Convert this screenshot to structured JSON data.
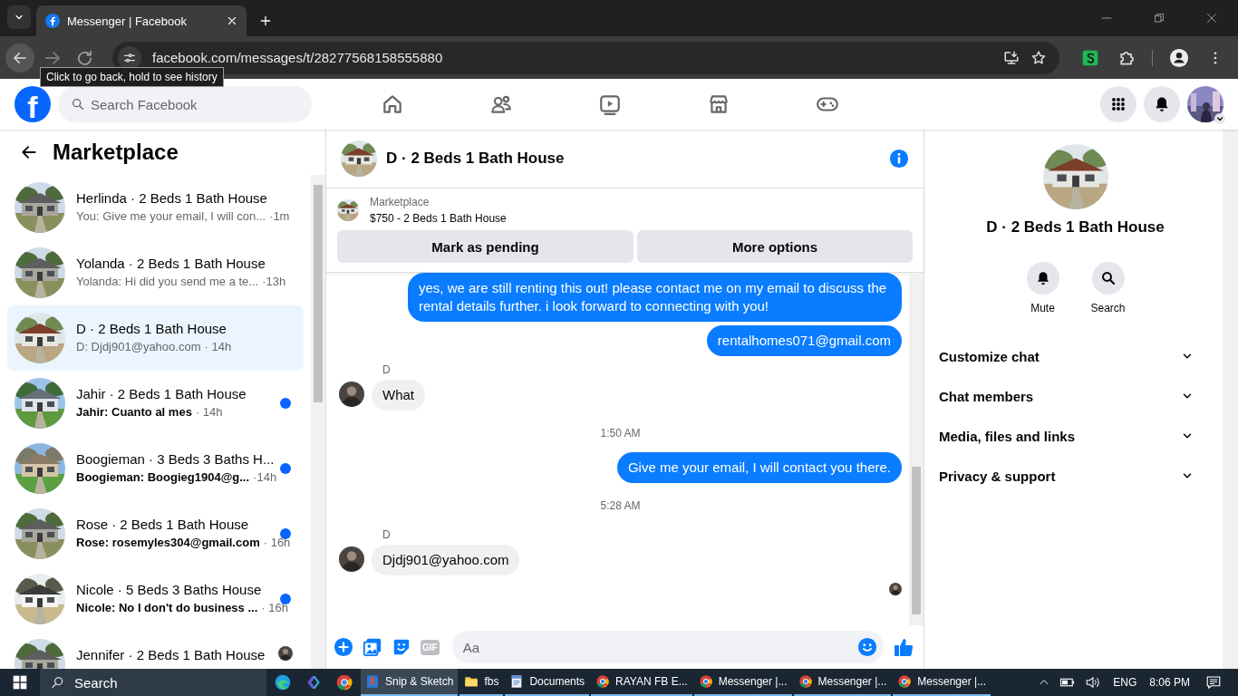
{
  "browser": {
    "tabs": [
      {
        "title": "Messenger | Facebook",
        "selected": true
      }
    ],
    "address": "facebook.com/messages/t/28277568158555880",
    "tooltip": "Click to go back, hold to see history"
  },
  "header": {
    "logo": "f",
    "search_placeholder": "Search Facebook"
  },
  "sidebar": {
    "title": "Marketplace",
    "conversations": [
      {
        "name": "Herlinda · 2 Beds 1 Bath House",
        "preview": "You: Give me your email, I will con...",
        "time": "·1m",
        "unread": false,
        "selected": false
      },
      {
        "name": "Yolanda · 2 Beds 1 Bath House",
        "preview": "Yolanda: Hi did you send me a te...",
        "time": "·13h",
        "unread": false,
        "selected": false
      },
      {
        "name": "D · 2 Beds 1 Bath House",
        "preview": "D: Djdj901@yahoo.com",
        "time": "· 14h",
        "unread": false,
        "selected": true
      },
      {
        "name": "Jahir · 2 Beds 1 Bath House",
        "preview": "Jahir: Cuanto al mes",
        "time": "· 14h",
        "unread": true,
        "selected": false
      },
      {
        "name": "Boogieman · 3 Beds 3 Baths H...",
        "preview": "Boogieman: Boogieg1904@g...",
        "time": "·14h",
        "unread": true,
        "selected": false
      },
      {
        "name": "Rose · 2 Beds 1 Bath House",
        "preview": "Rose: rosemyles304@gmail.com",
        "time": "· 16h",
        "unread": true,
        "selected": false
      },
      {
        "name": "Nicole · 5 Beds 3 Baths House",
        "preview": "Nicole: No I don't do business ...",
        "time": "· 16h",
        "unread": true,
        "selected": false
      },
      {
        "name": "Jennifer · 2 Beds 1 Bath House",
        "unread": false,
        "seen": true,
        "selected": false
      }
    ]
  },
  "chat": {
    "title": "D · 2 Beds 1 Bath House",
    "listing": {
      "label": "Marketplace",
      "title": "$750 - 2 Beds 1 Bath House"
    },
    "buttons": [
      "Mark as pending",
      "More options"
    ],
    "messages": [
      {
        "kind": "outgoing",
        "text": "yes, we are still renting this out! please contact me on my email to discuss the rental details further. i look forward to connecting with you!"
      },
      {
        "kind": "outgoing",
        "text": "rentalhomes071@gmail.com"
      },
      {
        "kind": "incoming",
        "sender": "D",
        "text": "What"
      },
      {
        "kind": "time",
        "text": "1:50 AM"
      },
      {
        "kind": "outgoing",
        "text": "Give me your email, I will contact you there."
      },
      {
        "kind": "time",
        "text": "5:28 AM"
      },
      {
        "kind": "incoming",
        "sender": "D",
        "text": "Djdj901@yahoo.com"
      }
    ],
    "seen": true,
    "composer": {
      "gif": "GIF",
      "placeholder": "Aa"
    }
  },
  "details": {
    "title": "D · 2 Beds 1 Bath House",
    "actions": [
      {
        "kind": "mute",
        "label": "Mute"
      },
      {
        "kind": "search",
        "label": "Search"
      }
    ],
    "sections": [
      {
        "label": "Customize chat",
        "expanded": false
      },
      {
        "label": "Chat members",
        "expanded": false
      },
      {
        "label": "Media, files and links",
        "expanded": false
      },
      {
        "label": "Privacy & support",
        "expanded": false
      }
    ]
  },
  "taskbar": {
    "search": "Search",
    "apps": [
      {
        "kind": "snip",
        "label": "Snip & Sketch",
        "selected": true
      },
      {
        "kind": "folder",
        "label": "fbs",
        "selected": false
      },
      {
        "kind": "document",
        "label": "Documents",
        "selected": false
      },
      {
        "kind": "chrome",
        "label": "RAYAN FB E...",
        "selected": false
      },
      {
        "kind": "chrome",
        "label": "Messenger |...",
        "selected": false
      },
      {
        "kind": "chrome",
        "label": "Messenger |...",
        "selected": false
      },
      {
        "kind": "chrome",
        "label": "Messenger |...",
        "selected": false
      }
    ],
    "language": "ENG",
    "time": "8:06 PM"
  }
}
